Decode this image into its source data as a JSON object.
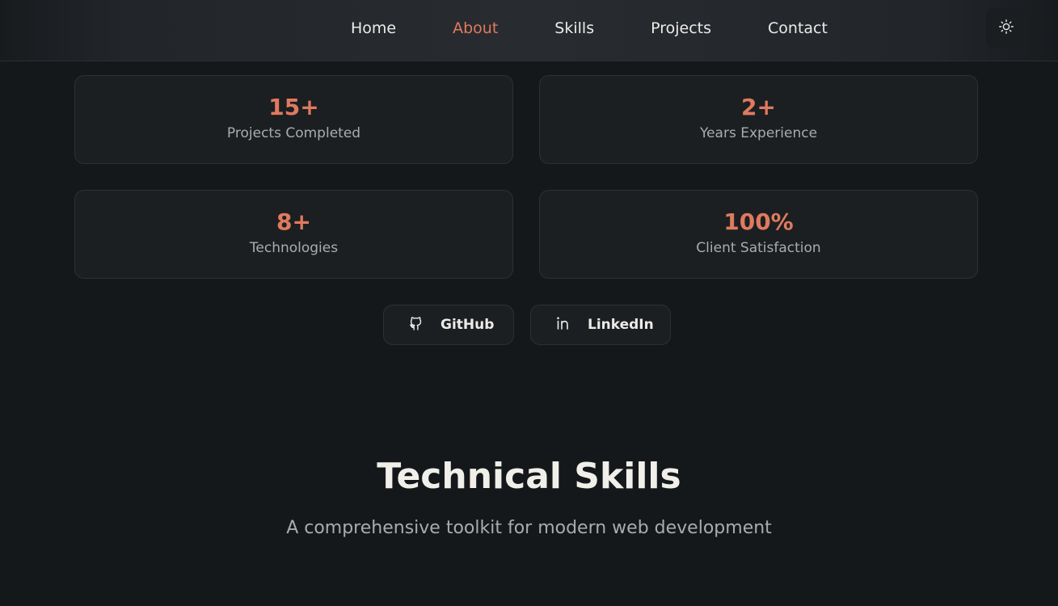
{
  "nav": {
    "links": [
      {
        "label": "Home"
      },
      {
        "label": "About"
      },
      {
        "label": "Skills"
      },
      {
        "label": "Projects"
      },
      {
        "label": "Contact"
      }
    ],
    "active_index": 1,
    "theme_toggle_icon": "sun-icon"
  },
  "stats": [
    {
      "value": "15+",
      "label": "Projects Completed"
    },
    {
      "value": "2+",
      "label": "Years Experience"
    },
    {
      "value": "8+",
      "label": "Technologies"
    },
    {
      "value": "100%",
      "label": "Client Satisfaction"
    }
  ],
  "social": {
    "github": {
      "label": "GitHub",
      "icon": "github-icon"
    },
    "linkedin": {
      "label": "LinkedIn",
      "icon": "linkedin-icon"
    }
  },
  "skills_section": {
    "title": "Technical Skills",
    "subtitle": "A comprehensive toolkit for modern web development"
  },
  "colors": {
    "accent": "#e07a5f",
    "background": "#15181b",
    "card": "#1c1f22"
  }
}
